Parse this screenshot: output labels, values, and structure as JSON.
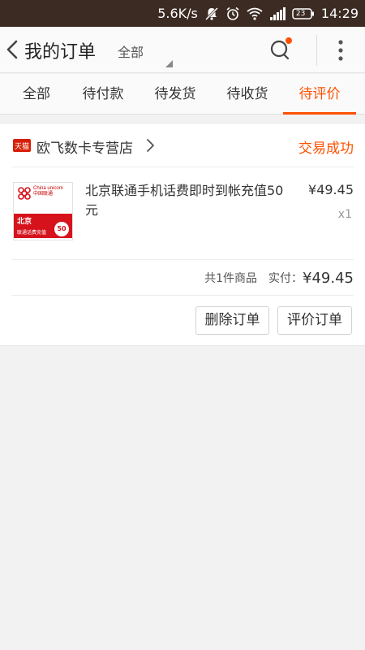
{
  "status_bar": {
    "net_speed": "5.6K/s",
    "battery": "23",
    "time": "14:29"
  },
  "header": {
    "title": "我的订单",
    "filter": "全部",
    "icons": [
      "back-arrow",
      "search",
      "more-vertical"
    ],
    "colors": {
      "accent": "#ff5000",
      "status_bar_bg": "#3b2b23"
    }
  },
  "tabs": [
    {
      "label": "全部"
    },
    {
      "label": "待付款"
    },
    {
      "label": "待发货"
    },
    {
      "label": "待收货"
    },
    {
      "label": "待评价",
      "active": true
    }
  ],
  "order": {
    "shop_badge": "天猫",
    "shop_name": "欧飞数卡专营店",
    "status": "交易成功",
    "product": {
      "title": "北京联通手机话费即时到帐充值50元",
      "price": "¥49.45",
      "quantity": "x1",
      "thumb": {
        "brand_en": "China unicom",
        "brand_cn": "中国联通",
        "city": "北京",
        "subtitle": "联通话费充值",
        "value": "50"
      }
    },
    "count_text": "共1件商品",
    "paid_label": "实付：",
    "paid_amount": "¥49.45",
    "buttons": {
      "delete": "删除订单",
      "review": "评价订单"
    }
  }
}
